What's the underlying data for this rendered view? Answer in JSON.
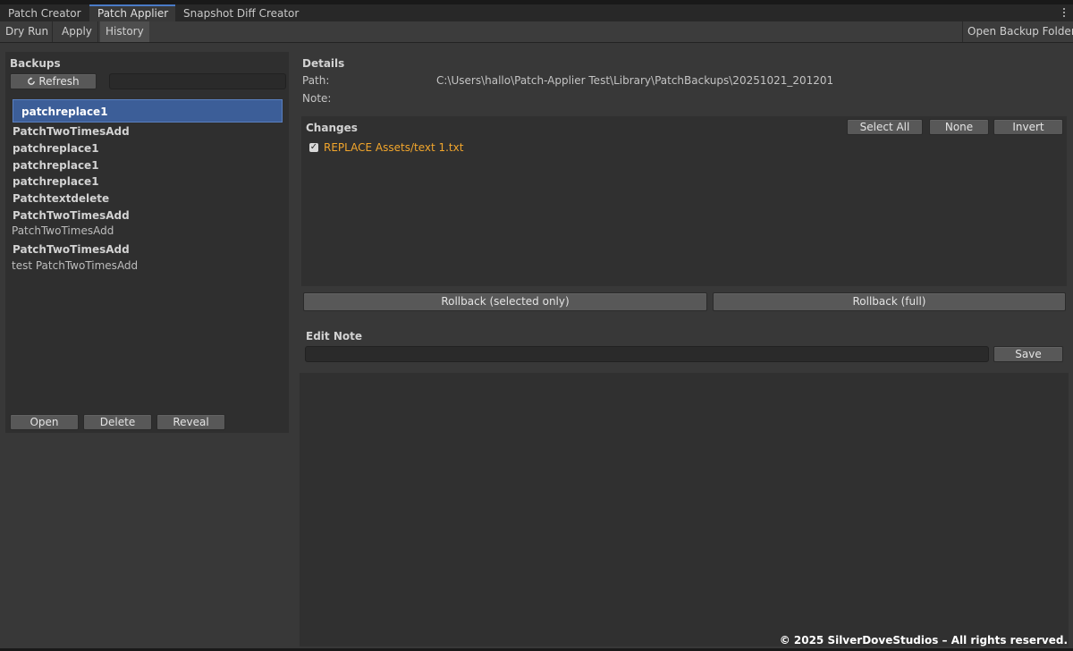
{
  "tabs": [
    {
      "label": "Patch Creator",
      "active": false
    },
    {
      "label": "Patch Applier",
      "active": true
    },
    {
      "label": "Snapshot Diff Creator",
      "active": false
    }
  ],
  "menu_icon": "kebab-menu-icon",
  "toolbar": {
    "dry_run": "Dry Run",
    "apply": "Apply",
    "history": "History",
    "open_backup_folder": "Open Backup Folder"
  },
  "backups": {
    "title": "Backups",
    "refresh_label": "Refresh",
    "refresh_icon": "refresh-icon",
    "search_value": "",
    "selected": "patchreplace1",
    "items": [
      {
        "name": "PatchTwoTimesAdd",
        "note": ""
      },
      {
        "name": "patchreplace1",
        "note": ""
      },
      {
        "name": "patchreplace1",
        "note": ""
      },
      {
        "name": "patchreplace1",
        "note": ""
      },
      {
        "name": "Patchtextdelete",
        "note": ""
      },
      {
        "name": "PatchTwoTimesAdd",
        "note": "PatchTwoTimesAdd"
      },
      {
        "name": "PatchTwoTimesAdd",
        "note": "test PatchTwoTimesAdd"
      }
    ],
    "open_label": "Open",
    "delete_label": "Delete",
    "reveal_label": "Reveal"
  },
  "details": {
    "title": "Details",
    "path_label": "Path:",
    "path_value": "C:\\Users\\hallo\\Patch-Applier Test\\Library\\PatchBackups\\20251021_201201",
    "note_label": "Note:",
    "note_value": ""
  },
  "changes": {
    "title": "Changes",
    "select_all_label": "Select All",
    "none_label": "None",
    "invert_label": "Invert",
    "items": [
      {
        "text": "REPLACE Assets/text 1.txt",
        "checked": true,
        "check_glyph": "✓"
      }
    ]
  },
  "rollback": {
    "selected_label": "Rollback (selected only)",
    "full_label": "Rollback (full)"
  },
  "edit_note": {
    "title": "Edit Note",
    "value": "",
    "save_label": "Save"
  },
  "footer": {
    "copyright": "© 2025 SilverDoveStudios – All rights reserved."
  },
  "colors": {
    "background": "#383838",
    "tab_accent": "#4a7bc7",
    "selection": "#3c5e98",
    "change_text": "#f2a62c"
  }
}
